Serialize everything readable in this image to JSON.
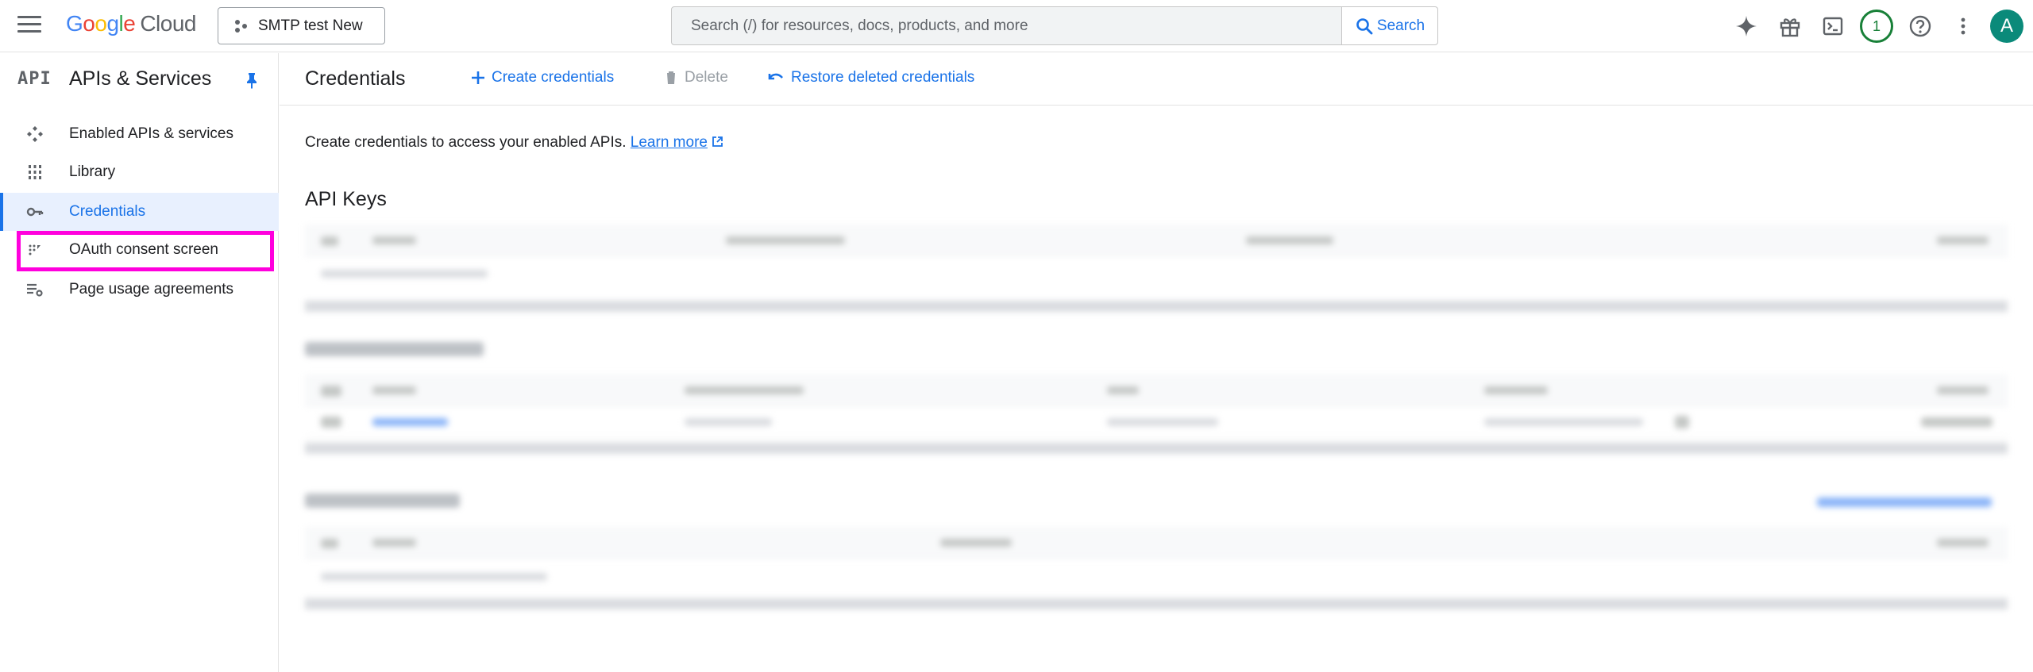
{
  "topbar": {
    "logo": {
      "g1": "G",
      "o1": "o",
      "o2": "o",
      "g2": "g",
      "l": "l",
      "e": "e",
      "product": "Cloud"
    },
    "project_name": "SMTP test New",
    "search_placeholder": "Search (/) for resources, docs, products, and more",
    "search_button": "Search",
    "notification_count": "1",
    "avatar_initial": "A"
  },
  "sidebar": {
    "badge": "API",
    "title": "APIs & Services",
    "items": [
      {
        "label": "Enabled APIs & services",
        "icon": "api-diamond-icon"
      },
      {
        "label": "Library",
        "icon": "library-grid-icon"
      },
      {
        "label": "Credentials",
        "icon": "key-icon",
        "active": true
      },
      {
        "label": "OAuth consent screen",
        "icon": "consent-dots-icon"
      },
      {
        "label": "Page usage agreements",
        "icon": "settings-list-icon"
      }
    ]
  },
  "main": {
    "title": "Credentials",
    "actions": {
      "create": "Create credentials",
      "delete": "Delete",
      "restore": "Restore deleted credentials"
    },
    "intro": {
      "text": "Create credentials to access your enabled APIs.",
      "link": "Learn more"
    },
    "api_keys_title": "API Keys"
  },
  "colors": {
    "accent": "#1a73e8",
    "highlight": "#ff00dd",
    "notification": "#188038",
    "avatar": "#0b8a7a"
  }
}
